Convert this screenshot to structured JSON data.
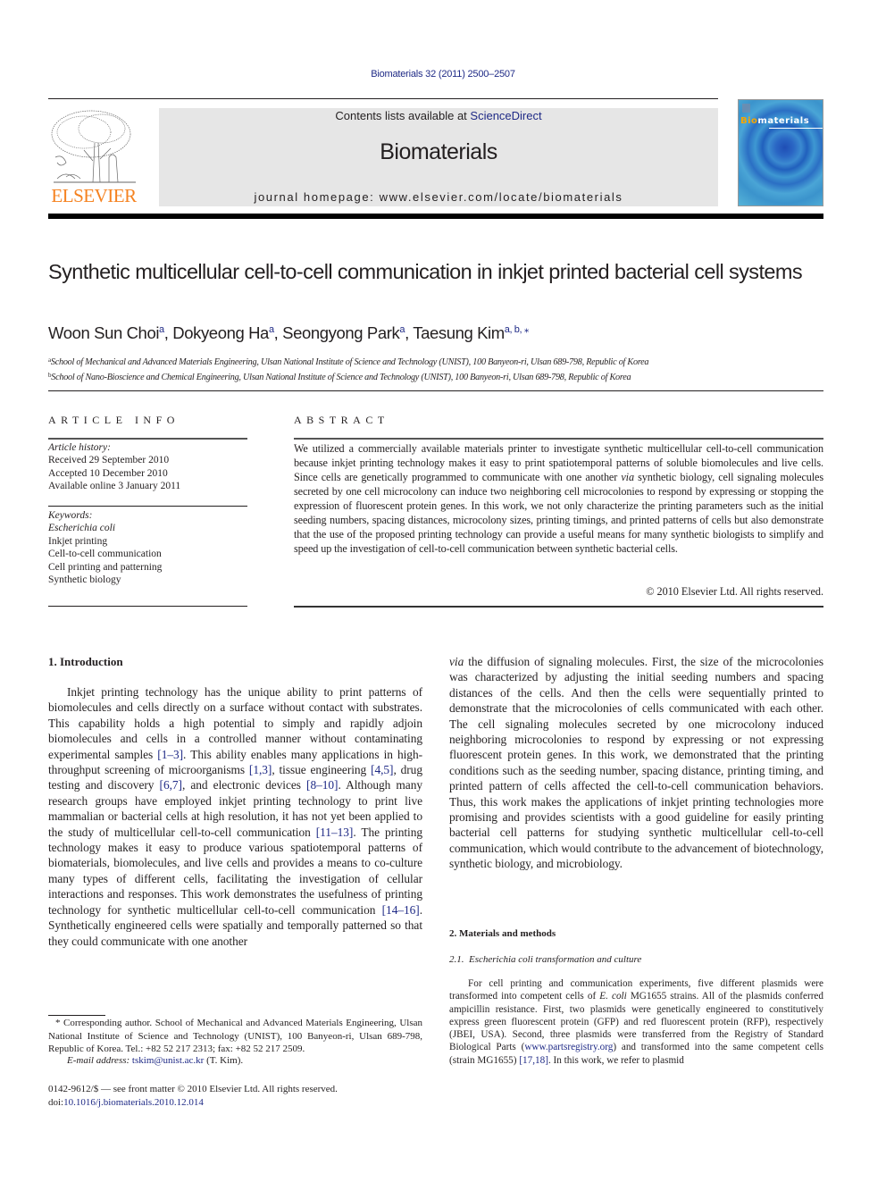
{
  "journal_ref": "Biomaterials 32 (2011) 2500–2507",
  "masthead": {
    "contents_prefix": "Contents lists available at ",
    "contents_link": "ScienceDirect",
    "journal_name": "Biomaterials",
    "homepage": "journal homepage: www.elsevier.com/locate/biomaterials"
  },
  "publisher_logo": "ELSEVIER",
  "cover": {
    "title_highlight": "Bio",
    "title_rest": "materials"
  },
  "article": {
    "title": "Synthetic multicellular cell-to-cell communication in inkjet printed bacterial cell systems",
    "authors": [
      {
        "name": "Woon Sun Choi",
        "sup": "a"
      },
      {
        "name": "Dokyeong Ha",
        "sup": "a"
      },
      {
        "name": "Seongyong Park",
        "sup": "a"
      },
      {
        "name": "Taesung Kim",
        "sup": "a, b, ⁎"
      }
    ],
    "affiliations": [
      {
        "sup": "a",
        "text": "School of Mechanical and Advanced Materials Engineering, Ulsan National Institute of Science and Technology (UNIST), 100 Banyeon-ri, Ulsan 689-798, Republic of Korea"
      },
      {
        "sup": "b",
        "text": "School of Nano-Bioscience and Chemical Engineering, Ulsan National Institute of Science and Technology (UNIST), 100 Banyeon-ri, Ulsan 689-798, Republic of Korea"
      }
    ]
  },
  "article_info": {
    "heading": "ARTICLE INFO",
    "history_label": "Article history:",
    "history": [
      "Received 29 September 2010",
      "Accepted 10 December 2010",
      "Available online 3 January 2011"
    ],
    "keywords_label": "Keywords:",
    "keywords": [
      "Escherichia coli",
      "Inkjet printing",
      "Cell-to-cell communication",
      "Cell printing and patterning",
      "Synthetic biology"
    ]
  },
  "abstract": {
    "heading": "ABSTRACT",
    "part1": "We utilized a commercially available materials printer to investigate synthetic multicellular cell-to-cell communication because inkjet printing technology makes it easy to print spatiotemporal patterns of soluble biomolecules and live cells. Since cells are genetically programmed to communicate with one another ",
    "part1_italic": "via",
    "part2": " synthetic biology, cell signaling molecules secreted by one cell microcolony can induce two neighboring cell microcolonies to respond by expressing or stopping the expression of fluorescent protein genes. In this work, we not only characterize the printing parameters such as the initial seeding numbers, spacing distances, microcolony sizes, printing timings, and printed patterns of cells but also demonstrate that the use of the proposed printing technology can provide a useful means for many synthetic biologists to simplify and speed up the investigation of cell-to-cell communication between synthetic bacterial cells.",
    "copyright": "© 2010 Elsevier Ltd. All rights reserved."
  },
  "introduction": {
    "heading": "1.  Introduction",
    "segments": [
      {
        "t": "Inkjet printing technology has the unique ability to print patterns of biomolecules and cells directly on a surface without contact with substrates. This capability holds a high potential to simply and rapidly adjoin biomolecules and cells in a controlled manner without contaminating experimental samples "
      },
      {
        "ref": "[1–3]"
      },
      {
        "t": ". This ability enables many applications in high-throughput screening of microorganisms "
      },
      {
        "ref": "[1,3]"
      },
      {
        "t": ", tissue engineering "
      },
      {
        "ref": "[4,5]"
      },
      {
        "t": ", drug testing and discovery "
      },
      {
        "ref": "[6,7]"
      },
      {
        "t": ", and electronic devices "
      },
      {
        "ref": "[8–10]"
      },
      {
        "t": ". Although many research groups have employed inkjet printing technology to print live mammalian or bacterial cells at high resolution, it has not yet been applied to the study of multicellular cell-to-cell communication "
      },
      {
        "ref": "[11–13]"
      },
      {
        "t": ". The printing technology makes it easy to produce various spatiotemporal patterns of biomaterials, biomolecules, and live cells and provides a means to co-culture many types of different cells, facilitating the investigation of cellular interactions and responses. This work demonstrates the usefulness of printing technology for synthetic multicellular cell-to-cell communication "
      },
      {
        "ref": "[14–16]"
      },
      {
        "t": ". Synthetically engineered cells were spatially and temporally patterned so that they could communicate with one another"
      }
    ],
    "continued_italic": "via",
    "continued": " the diffusion of signaling molecules. First, the size of the microcolonies was characterized by adjusting the initial seeding numbers and spacing distances of the cells. And then the cells were sequentially printed to demonstrate that the microcolonies of cells communicated with each other. The cell signaling molecules secreted by one microcolony induced neighboring microcolonies to respond by expressing or not expressing fluorescent protein genes. In this work, we demonstrated that the printing conditions such as the seeding number, spacing distance, printing timing, and printed pattern of cells affected the cell-to-cell communication behaviors. Thus, this work makes the applications of inkjet printing technologies more promising and provides scientists with a good guideline for easily printing bacterial cell patterns for studying synthetic multicellular cell-to-cell communication, which would contribute to the advancement of biotechnology, synthetic biology, and microbiology."
  },
  "methods": {
    "heading": "2.  Materials and methods",
    "subheading_num": "2.1.",
    "subheading": "Escherichia coli transformation and culture",
    "t1": "For cell printing and communication experiments, five different plasmids were transformed into competent cells of ",
    "t1_italic": "E. coli",
    "t2": " MG1655 strains. All of the plasmids conferred ampicillin resistance. First, two plasmids were genetically engineered to constitutively express green fluorescent protein (GFP) and red fluorescent protein (RFP), respectively (JBEI, USA). Second, three plasmids were transferred from the Registry of Standard Biological Parts (",
    "link": "www.partsregistry.org",
    "t3": ") and transformed into the same competent cells (strain MG1655) ",
    "ref": "[17,18]",
    "t4": ". In this work, we refer to plasmid"
  },
  "footnote": {
    "star": "* ",
    "text": "Corresponding author. School of Mechanical and Advanced Materials Engineering, Ulsan National Institute of Science and Technology (UNIST), 100 Banyeon-ri, Ulsan 689-798, Republic of Korea. Tel.: +82 52 217 2313; fax: +82 52 217 2509.",
    "email_label": "E-mail address:",
    "email": "tskim@unist.ac.kr",
    "email_suffix": " (T. Kim)."
  },
  "front_matter": {
    "issn_line": "0142-9612/$ — see front matter © 2010 Elsevier Ltd. All rights reserved.",
    "doi_prefix": "doi:",
    "doi": "10.1016/j.biomaterials.2010.12.014"
  }
}
